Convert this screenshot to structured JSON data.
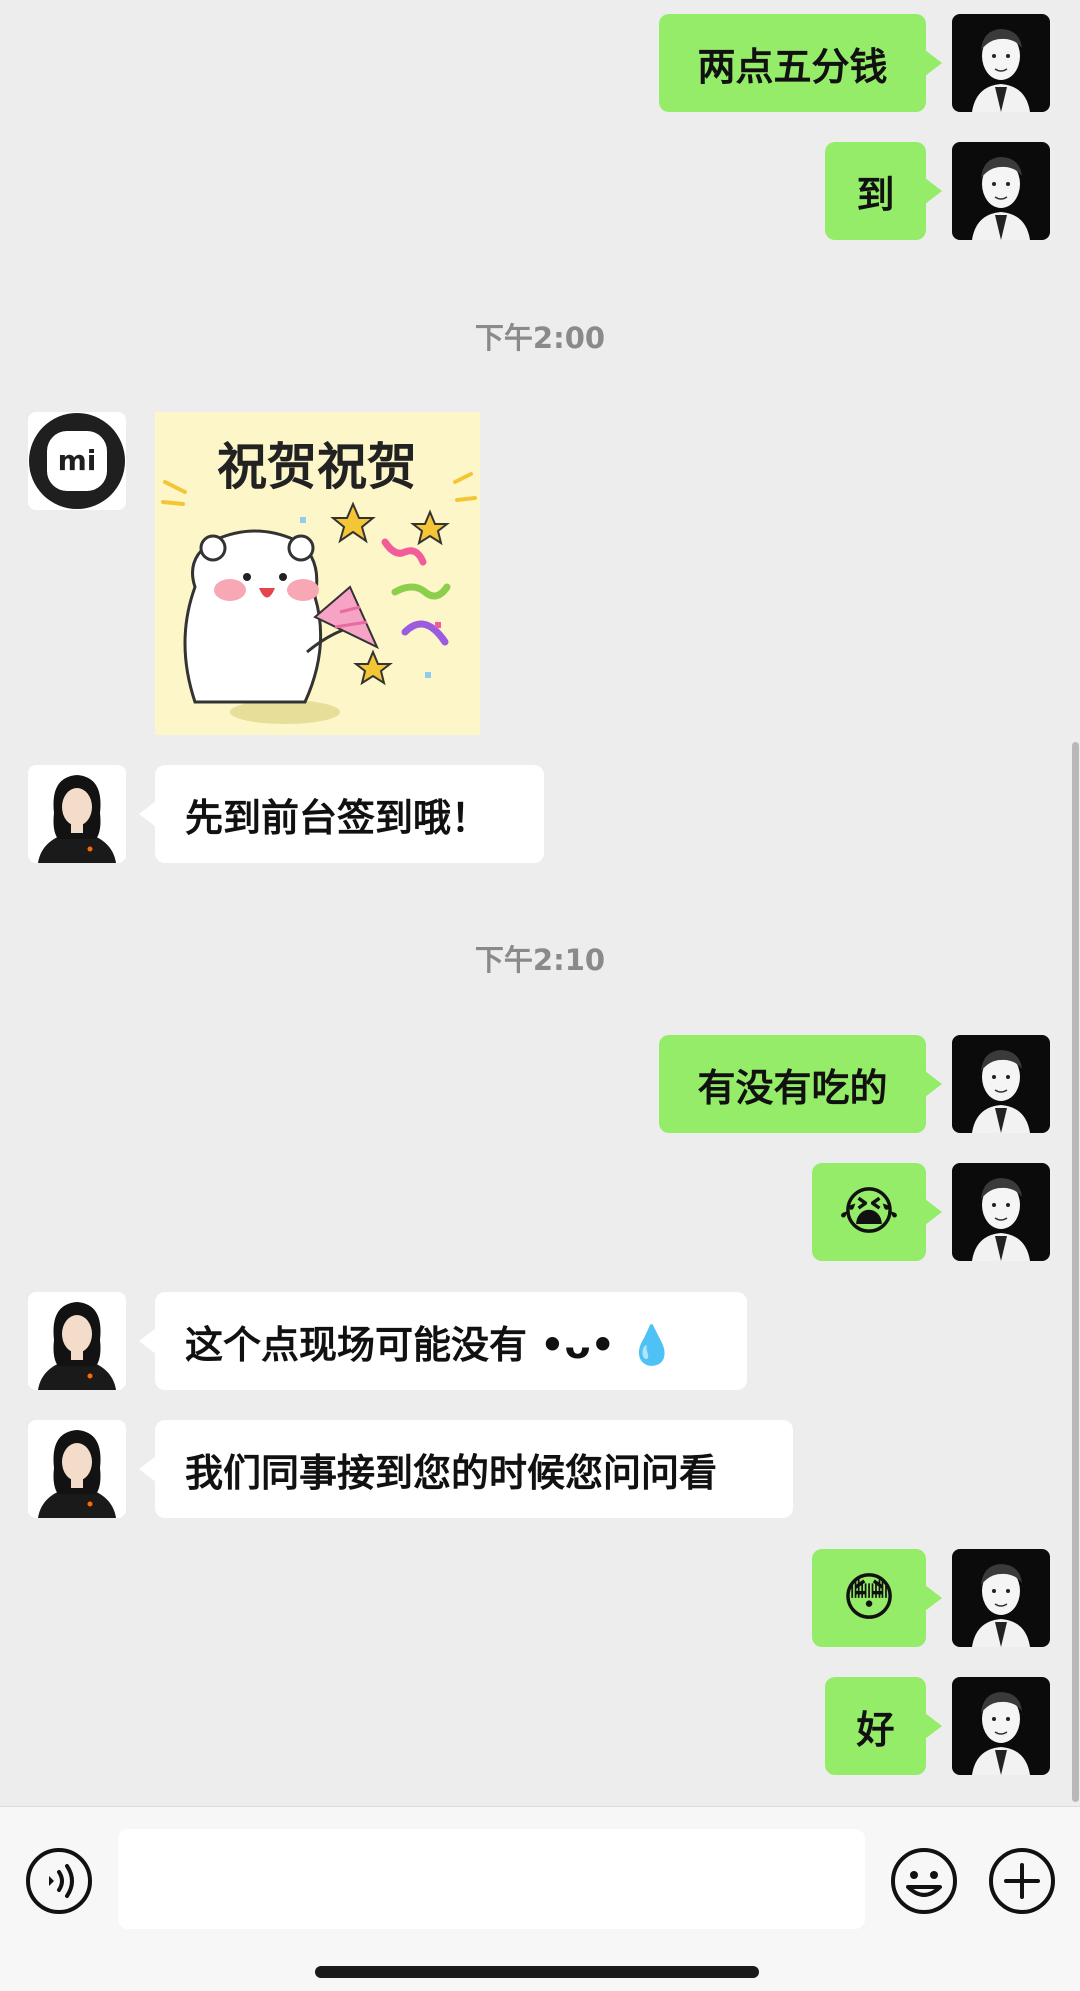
{
  "messages_top": [
    {
      "text": "两点五分钱"
    },
    {
      "text": "到"
    }
  ],
  "timestamps": [
    "下午2:00",
    "下午2:10"
  ],
  "sticker": {
    "text": "祝贺祝贺"
  },
  "message_checkin": {
    "text": "先到前台签到哦！"
  },
  "message_food": {
    "text": "有没有吃的"
  },
  "message_cry": {
    "emoji": "😭"
  },
  "message_none": {
    "text": "这个点现场可能没有 •ᴗ• 💧"
  },
  "message_ask": {
    "text": "我们同事接到您的时候您问问看"
  },
  "message_flushed": {
    "emoji": "😳"
  },
  "message_ok": {
    "text": "好"
  },
  "avatar_xiaomi": {
    "logo_text": "mi"
  },
  "input": {
    "placeholder": ""
  },
  "colors": {
    "sent_bubble": "#95EC69",
    "received_bubble": "#FFFFFF",
    "background": "#EDEDED"
  },
  "icons": {
    "voice": "voice-icon",
    "emoji": "emoji-icon",
    "plus": "plus-icon"
  }
}
